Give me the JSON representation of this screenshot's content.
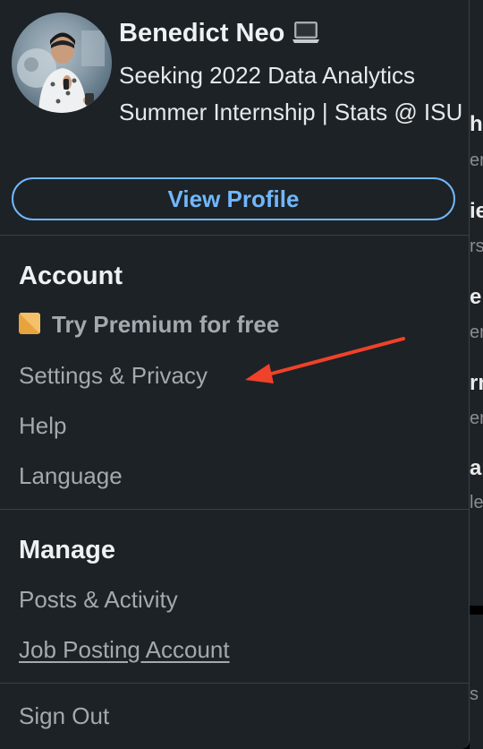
{
  "profile": {
    "name": "Benedict Neo",
    "name_icon": "laptop-icon",
    "headline": "Seeking 2022 Data Analytics Summer Internship | Stats @ ISU",
    "view_profile_label": "View Profile"
  },
  "account": {
    "title": "Account",
    "premium_label": "Try Premium for free",
    "premium_icon": "premium-gold-icon",
    "premium_color": "#e7a33e",
    "items": [
      "Settings & Privacy",
      "Help",
      "Language"
    ]
  },
  "manage": {
    "title": "Manage",
    "items": [
      "Posts & Activity",
      "Job Posting Account"
    ]
  },
  "sign_out_label": "Sign Out",
  "annotation": {
    "type": "red-arrow",
    "target": "Settings & Privacy",
    "color": "#f0412a"
  },
  "colors": {
    "background": "#1d2226",
    "link_blue": "#71b7fb",
    "muted_text": "#a3a9ae",
    "divider": "#3b4044"
  },
  "background_fragments": [
    "h",
    "er",
    "ie",
    "rs",
    "e s",
    "er",
    "rn",
    "er",
    "ar",
    "le",
    "s a"
  ]
}
